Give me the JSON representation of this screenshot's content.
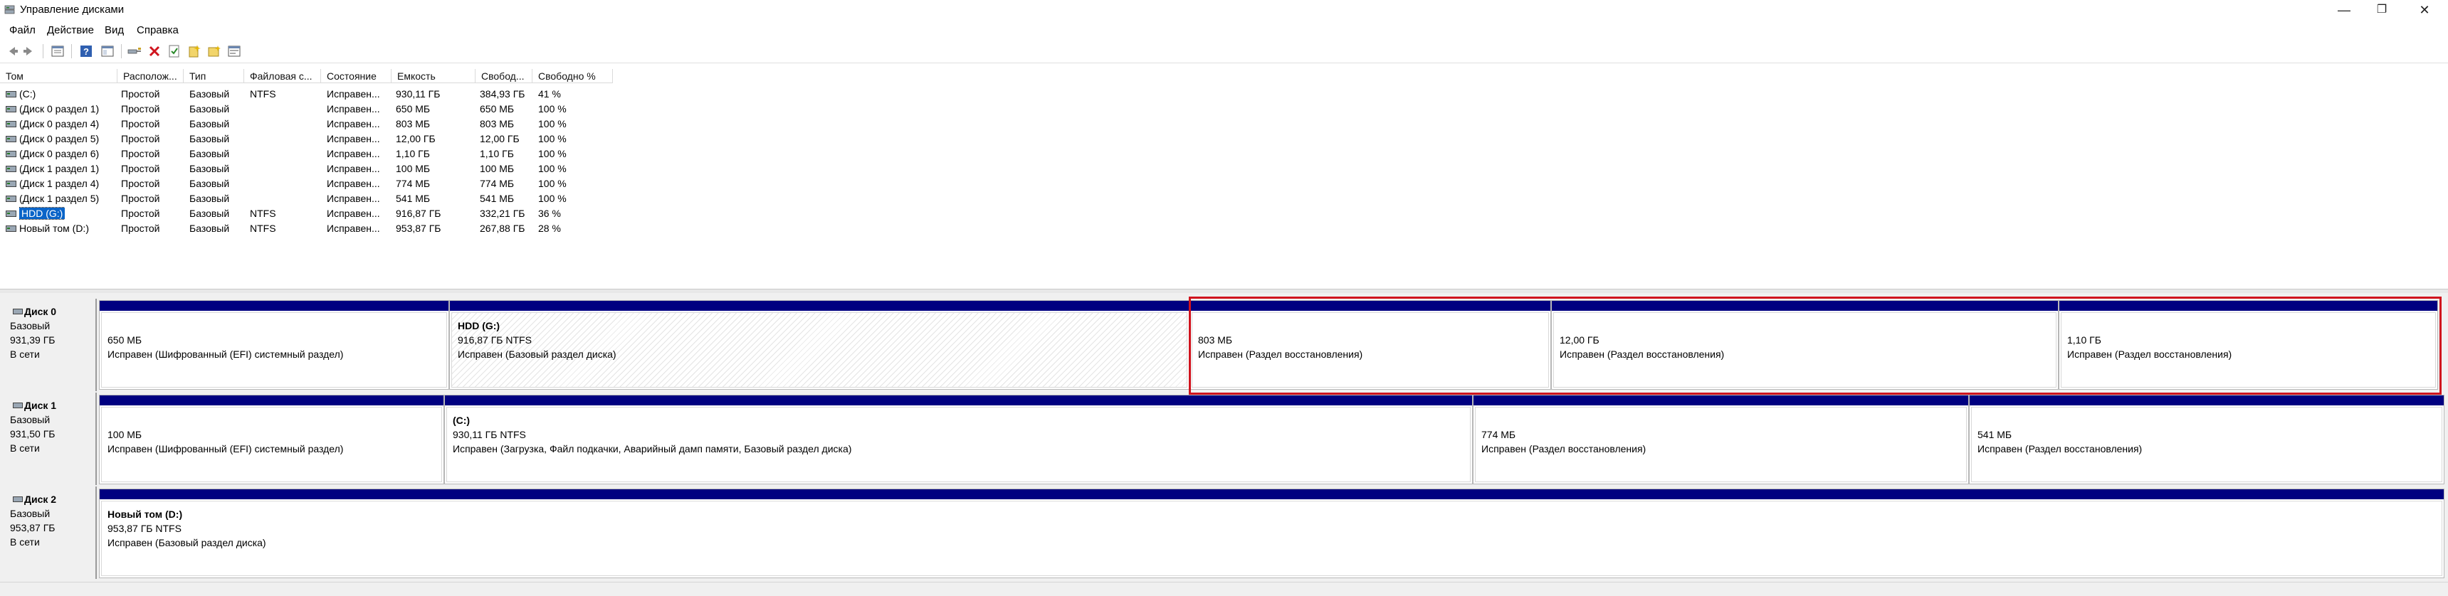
{
  "window": {
    "title": "Управление дисками",
    "controls": {
      "minimize": "—",
      "maximize": "❐",
      "close": "✕"
    }
  },
  "menu": [
    "Файл",
    "Действие",
    "Вид",
    "Справка"
  ],
  "toolbar": {
    "icons": [
      "back-icon",
      "forward-icon",
      "properties-list-icon",
      "help-icon",
      "console-view-icon",
      "connect-disk-icon",
      "delete-icon",
      "check-icon",
      "new-volume-icon",
      "folder-icon",
      "settings-icon"
    ]
  },
  "volume_table": {
    "columns": [
      "Том",
      "Располож...",
      "Тип",
      "Файловая с...",
      "Состояние",
      "Емкость",
      "Свобод...",
      "Свободно %"
    ],
    "rows": [
      {
        "name": "(C:)",
        "layout": "Простой",
        "type": "Базовый",
        "fs": "NTFS",
        "status": "Исправен...",
        "capacity": "930,11 ГБ",
        "free": "384,93 ГБ",
        "free_pct": "41 %"
      },
      {
        "name": "(Диск 0 раздел 1)",
        "layout": "Простой",
        "type": "Базовый",
        "fs": "",
        "status": "Исправен...",
        "capacity": "650 МБ",
        "free": "650 МБ",
        "free_pct": "100 %"
      },
      {
        "name": "(Диск 0 раздел 4)",
        "layout": "Простой",
        "type": "Базовый",
        "fs": "",
        "status": "Исправен...",
        "capacity": "803 МБ",
        "free": "803 МБ",
        "free_pct": "100 %"
      },
      {
        "name": "(Диск 0 раздел 5)",
        "layout": "Простой",
        "type": "Базовый",
        "fs": "",
        "status": "Исправен...",
        "capacity": "12,00 ГБ",
        "free": "12,00 ГБ",
        "free_pct": "100 %"
      },
      {
        "name": "(Диск 0 раздел 6)",
        "layout": "Простой",
        "type": "Базовый",
        "fs": "",
        "status": "Исправен...",
        "capacity": "1,10 ГБ",
        "free": "1,10 ГБ",
        "free_pct": "100 %"
      },
      {
        "name": "(Диск 1 раздел 1)",
        "layout": "Простой",
        "type": "Базовый",
        "fs": "",
        "status": "Исправен...",
        "capacity": "100 МБ",
        "free": "100 МБ",
        "free_pct": "100 %"
      },
      {
        "name": "(Диск 1 раздел 4)",
        "layout": "Простой",
        "type": "Базовый",
        "fs": "",
        "status": "Исправен...",
        "capacity": "774 МБ",
        "free": "774 МБ",
        "free_pct": "100 %"
      },
      {
        "name": "(Диск 1 раздел 5)",
        "layout": "Простой",
        "type": "Базовый",
        "fs": "",
        "status": "Исправен...",
        "capacity": "541 МБ",
        "free": "541 МБ",
        "free_pct": "100 %"
      },
      {
        "name": "HDD (G:)",
        "layout": "Простой",
        "type": "Базовый",
        "fs": "NTFS",
        "status": "Исправен...",
        "capacity": "916,87 ГБ",
        "free": "332,21 ГБ",
        "free_pct": "36 %",
        "selected": true
      },
      {
        "name": "Новый том (D:)",
        "layout": "Простой",
        "type": "Базовый",
        "fs": "NTFS",
        "status": "Исправен...",
        "capacity": "953,87 ГБ",
        "free": "267,88 ГБ",
        "free_pct": "28 %"
      }
    ]
  },
  "disks": [
    {
      "name": "Диск 0",
      "type": "Базовый",
      "size": "931,39 ГБ",
      "state": "В сети",
      "partitions": [
        {
          "title": "",
          "size": "650 МБ",
          "status": "Исправен (Шифрованный (EFI) системный раздел)"
        },
        {
          "title": "HDD  (G:)",
          "size": "916,87 ГБ NTFS",
          "status": "Исправен (Базовый раздел диска)",
          "selected": true
        },
        {
          "title": "",
          "size": "803 МБ",
          "status": "Исправен (Раздел восстановления)"
        },
        {
          "title": "",
          "size": "12,00 ГБ",
          "status": "Исправен (Раздел восстановления)"
        },
        {
          "title": "",
          "size": "1,10 ГБ",
          "status": "Исправен (Раздел восстановления)"
        }
      ]
    },
    {
      "name": "Диск 1",
      "type": "Базовый",
      "size": "931,50 ГБ",
      "state": "В сети",
      "partitions": [
        {
          "title": "",
          "size": "100 МБ",
          "status": "Исправен (Шифрованный (EFI) системный раздел)"
        },
        {
          "title": "(C:)",
          "size": "930,11 ГБ NTFS",
          "status": "Исправен (Загрузка, Файл подкачки, Аварийный дамп памяти, Базовый раздел диска)"
        },
        {
          "title": "",
          "size": "774 МБ",
          "status": "Исправен (Раздел восстановления)"
        },
        {
          "title": "",
          "size": "541 МБ",
          "status": "Исправен (Раздел восстановления)"
        }
      ]
    },
    {
      "name": "Диск 2",
      "type": "Базовый",
      "size": "953,87 ГБ",
      "state": "В сети",
      "partitions": [
        {
          "title": "Новый том  (D:)",
          "size": "953,87 ГБ NTFS",
          "status": "Исправен (Базовый раздел диска)"
        }
      ]
    }
  ],
  "colors": {
    "partition_bar": "#000080",
    "selection": "#0a64c8",
    "highlight": "#d0141e"
  }
}
